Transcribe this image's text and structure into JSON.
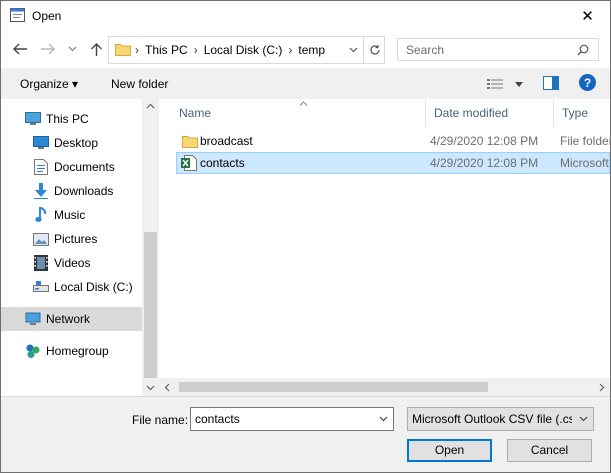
{
  "window": {
    "title": "Open",
    "close_glyph": "✕"
  },
  "nav_buttons": {
    "back": "back-icon",
    "forward": "forward-icon",
    "recent": "chevron-down-icon",
    "up": "up-icon"
  },
  "address": {
    "segments": [
      "This PC",
      "Local Disk (C:)",
      "temp"
    ],
    "separator": "›"
  },
  "search": {
    "placeholder": "Search"
  },
  "toolbar": {
    "organize": "Organize ▾",
    "new_folder": "New folder"
  },
  "nav_pane": {
    "items": [
      {
        "label": "This PC",
        "icon": "pc-icon"
      },
      {
        "label": "Desktop",
        "icon": "desktop-icon"
      },
      {
        "label": "Documents",
        "icon": "documents-icon"
      },
      {
        "label": "Downloads",
        "icon": "downloads-icon"
      },
      {
        "label": "Music",
        "icon": "music-icon"
      },
      {
        "label": "Pictures",
        "icon": "pictures-icon"
      },
      {
        "label": "Videos",
        "icon": "videos-icon"
      },
      {
        "label": "Local Disk (C:)",
        "icon": "disk-icon"
      },
      {
        "label": "Network",
        "icon": "network-icon"
      },
      {
        "label": "Homegroup",
        "icon": "homegroup-icon"
      }
    ]
  },
  "file_list": {
    "columns": [
      "Name",
      "Date modified",
      "Type"
    ],
    "rows": [
      {
        "name": "broadcast",
        "date": "4/29/2020 12:08 PM",
        "type": "File folder",
        "icon": "folder-icon"
      },
      {
        "name": "contacts",
        "date": "4/29/2020 12:08 PM",
        "type": "Microsoft",
        "icon": "excel-csv-icon"
      }
    ]
  },
  "bottom": {
    "file_name_label": "File name:",
    "file_name_value": "contacts",
    "file_type_value": "Microsoft Outlook CSV file (.csv)",
    "open_label": "Open",
    "cancel_label": "Cancel"
  },
  "colors": {
    "accent": "#0078d7",
    "selection": "#cce8ff",
    "folder": "#f8d775",
    "excel": "#217346"
  }
}
